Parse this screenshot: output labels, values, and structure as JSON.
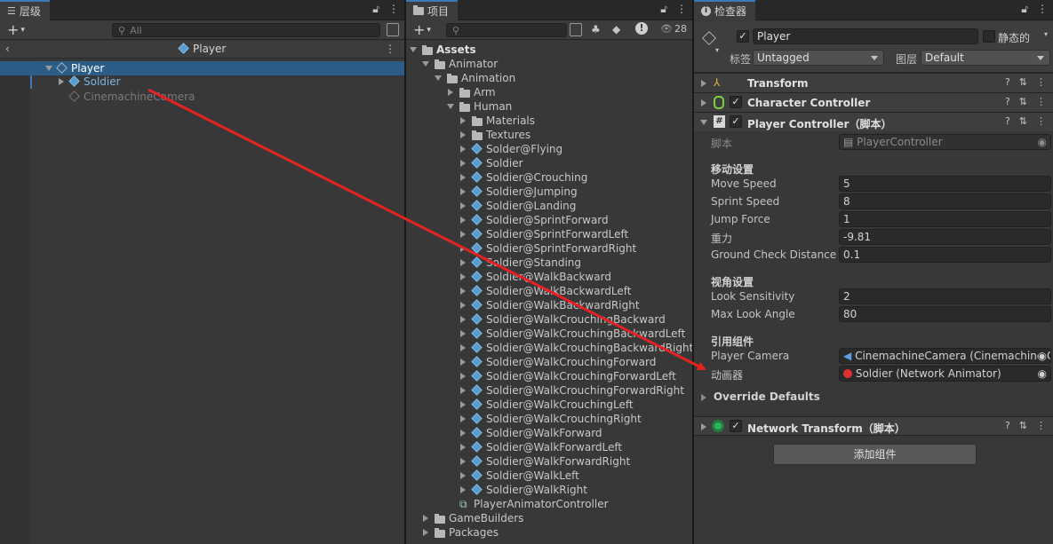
{
  "hierarchy": {
    "tab_label": "层级",
    "search_placeholder": "All",
    "scene_title": "Player",
    "items": [
      {
        "label": "Player",
        "selected": true
      },
      {
        "label": "Soldier"
      },
      {
        "label": "CinemachineCamera"
      }
    ]
  },
  "project": {
    "tab_label": "项目",
    "visibility_count": "28",
    "tree": [
      {
        "label": "Assets",
        "depth": 0,
        "type": "folder",
        "expanded": true
      },
      {
        "label": "Animator",
        "depth": 1,
        "type": "folder",
        "expanded": true
      },
      {
        "label": "Animation",
        "depth": 2,
        "type": "folder",
        "expanded": true
      },
      {
        "label": "Arm",
        "depth": 3,
        "type": "folder"
      },
      {
        "label": "Human",
        "depth": 3,
        "type": "folder",
        "expanded": true
      },
      {
        "label": "Materials",
        "depth": 4,
        "type": "folder"
      },
      {
        "label": "Textures",
        "depth": 4,
        "type": "folder"
      },
      {
        "label": "Solder@Flying",
        "depth": 4,
        "type": "model"
      },
      {
        "label": "Soldier",
        "depth": 4,
        "type": "model"
      },
      {
        "label": "Soldier@Crouching",
        "depth": 4,
        "type": "model"
      },
      {
        "label": "Soldier@Jumping",
        "depth": 4,
        "type": "model"
      },
      {
        "label": "Soldier@Landing",
        "depth": 4,
        "type": "model"
      },
      {
        "label": "Soldier@SprintForward",
        "depth": 4,
        "type": "model"
      },
      {
        "label": "Soldier@SprintForwardLeft",
        "depth": 4,
        "type": "model"
      },
      {
        "label": "Soldier@SprintForwardRight",
        "depth": 4,
        "type": "model"
      },
      {
        "label": "Soldier@Standing",
        "depth": 4,
        "type": "model"
      },
      {
        "label": "Soldier@WalkBackward",
        "depth": 4,
        "type": "model"
      },
      {
        "label": "Soldier@WalkBackwardLeft",
        "depth": 4,
        "type": "model"
      },
      {
        "label": "Soldier@WalkBackwardRight",
        "depth": 4,
        "type": "model"
      },
      {
        "label": "Soldier@WalkCrouchingBackward",
        "depth": 4,
        "type": "model"
      },
      {
        "label": "Soldier@WalkCrouchingBackwardLeft",
        "depth": 4,
        "type": "model"
      },
      {
        "label": "Soldier@WalkCrouchingBackwardRight",
        "depth": 4,
        "type": "model"
      },
      {
        "label": "Soldier@WalkCrouchingForward",
        "depth": 4,
        "type": "model"
      },
      {
        "label": "Soldier@WalkCrouchingForwardLeft",
        "depth": 4,
        "type": "model"
      },
      {
        "label": "Soldier@WalkCrouchingForwardRight",
        "depth": 4,
        "type": "model"
      },
      {
        "label": "Soldier@WalkCrouchingLeft",
        "depth": 4,
        "type": "model"
      },
      {
        "label": "Soldier@WalkCrouchingRight",
        "depth": 4,
        "type": "model"
      },
      {
        "label": "Soldier@WalkForward",
        "depth": 4,
        "type": "model"
      },
      {
        "label": "Soldier@WalkForwardLeft",
        "depth": 4,
        "type": "model"
      },
      {
        "label": "Soldier@WalkForwardRight",
        "depth": 4,
        "type": "model"
      },
      {
        "label": "Soldier@WalkLeft",
        "depth": 4,
        "type": "model"
      },
      {
        "label": "Soldier@WalkRight",
        "depth": 4,
        "type": "model"
      },
      {
        "label": "PlayerAnimatorController",
        "depth": 3,
        "type": "controller"
      },
      {
        "label": "GameBuilders",
        "depth": 1,
        "type": "folder"
      },
      {
        "label": "Packages",
        "depth": 1,
        "type": "folder"
      }
    ]
  },
  "inspector": {
    "tab_label": "检查器",
    "object_name": "Player",
    "static_label": "静态的",
    "tag_label": "标签",
    "tag_value": "Untagged",
    "layer_label": "图层",
    "layer_value": "Default",
    "components": {
      "transform": "Transform",
      "character_controller": "Character Controller",
      "player_controller": "Player Controller（脚本）",
      "network_transform": "Network Transform（脚本）"
    },
    "script_label": "脚本",
    "script_value": "PlayerController",
    "movement_header": "移动设置",
    "movement_fields": [
      {
        "label": "Move Speed",
        "value": "5"
      },
      {
        "label": "Sprint Speed",
        "value": "8"
      },
      {
        "label": "Jump Force",
        "value": "1"
      },
      {
        "label": "重力",
        "value": "-9.81"
      },
      {
        "label": "Ground Check Distance",
        "value": "0.1"
      }
    ],
    "view_header": "视角设置",
    "view_fields": [
      {
        "label": "Look Sensitivity",
        "value": "2"
      },
      {
        "label": "Max Look Angle",
        "value": "80"
      }
    ],
    "ref_header": "引用组件",
    "ref_fields": [
      {
        "label": "Player Camera",
        "value": "CinemachineCamera (Cinemachine C"
      },
      {
        "label": "动画器",
        "value": "Soldier (Network Animator)"
      }
    ],
    "override_label": "Override Defaults",
    "add_component": "添加组件"
  },
  "colors": {
    "selection": "#2c5d87",
    "panel_bg": "#383838",
    "arrow": "#e52222",
    "accent": "#3a79bb"
  }
}
